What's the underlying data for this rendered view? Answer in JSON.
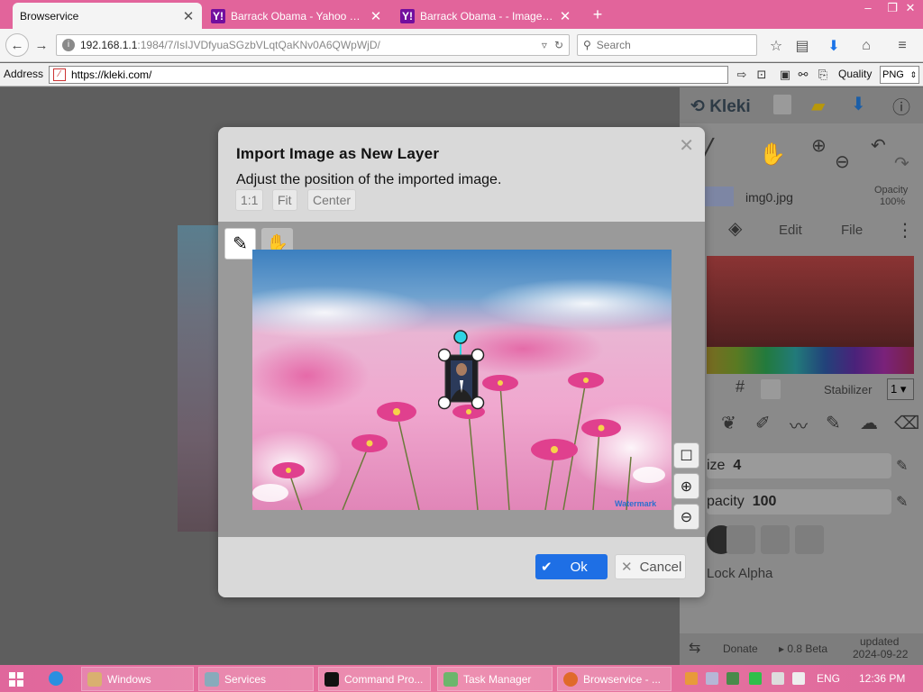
{
  "browser": {
    "tabs": [
      {
        "title": "Browservice",
        "active": true
      },
      {
        "title": "Barrack Obama - Yahoo Se...",
        "active": false
      },
      {
        "title": "Barrack Obama - - Image S...",
        "active": false
      }
    ],
    "url_host": "192.168.1.1",
    "url_path": ":1984/7/IsIJVDfyuaSGzbVLqtQaKNv0A6QWpWjD/",
    "search_placeholder": "Search",
    "address_label": "Address",
    "address_value": "https://kleki.com/",
    "quality_label": "Quality",
    "quality_value": "PNG"
  },
  "kleki": {
    "logo": "Kleki",
    "layer_name": "img0.jpg",
    "opacity_label": "Opacity",
    "opacity_value": "100%",
    "tab_edit": "Edit",
    "tab_file": "File",
    "stabilizer_label": "Stabilizer",
    "stabilizer_value": "1",
    "size_label": "ize",
    "size_value": "4",
    "opacity_slider_label": "pacity",
    "opacity_slider_value": "100",
    "lock_alpha": "Lock Alpha",
    "donate": "Donate",
    "version": "0.8 Beta",
    "updated_label": "updated",
    "updated_date": "2024-09-22"
  },
  "dialog": {
    "title": "Import Image as New Layer",
    "description": "Adjust the position of the imported image.",
    "btn_1to1": "1:1",
    "btn_fit": "Fit",
    "btn_center": "Center",
    "watermark": "Watermark",
    "ok_label": "Ok",
    "cancel_label": "Cancel"
  },
  "taskbar": {
    "items": [
      "Windows",
      "Services",
      "Command Pro...",
      "Task Manager",
      "Browservice - ..."
    ],
    "language": "ENG",
    "time": "12:36 PM"
  },
  "colors": {
    "accent_pink": "#e2649b",
    "ok_blue": "#1e6fe5",
    "handle_cyan": "#2fd4e4"
  }
}
